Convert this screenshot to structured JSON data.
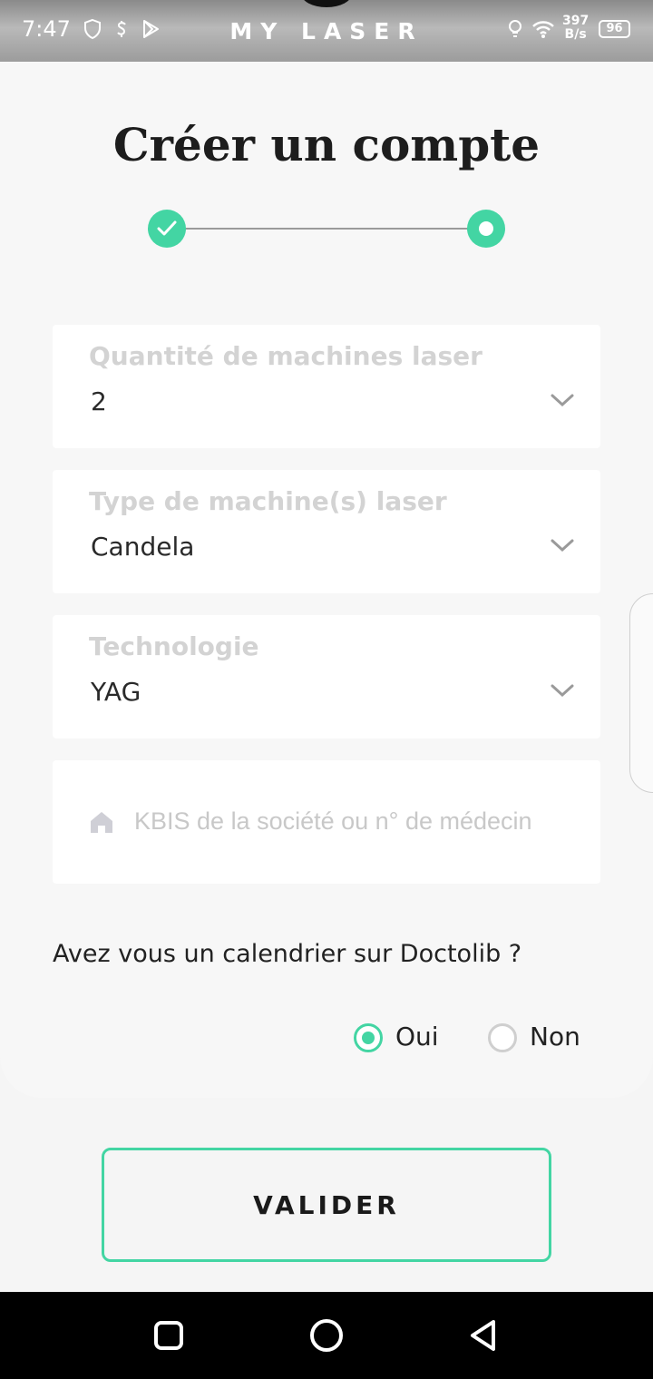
{
  "status_bar": {
    "time": "7:47",
    "app_title": "MY LASER",
    "net_speed_value": "397",
    "net_speed_unit": "B/s",
    "battery": "96"
  },
  "page": {
    "title": "Créer un compte",
    "steps": [
      {
        "state": "completed"
      },
      {
        "state": "active"
      }
    ]
  },
  "form": {
    "quantity": {
      "label": "Quantité de machines laser",
      "value": "2"
    },
    "machine_type": {
      "label": "Type de machine(s) laser",
      "value": "Candela"
    },
    "technology": {
      "label": "Technologie",
      "value": "YAG"
    },
    "kbis": {
      "placeholder": "KBIS de la société ou n° de médecin",
      "icon": "home-icon"
    }
  },
  "doctolib": {
    "question": "Avez vous un calendrier sur Doctolib ?",
    "options": [
      {
        "label": "Oui",
        "selected": true
      },
      {
        "label": "Non",
        "selected": false
      }
    ]
  },
  "submit_label": "VALIDER",
  "colors": {
    "accent": "#43d5a3",
    "background": "#f5f5f5",
    "label_grey": "#d3d3d3",
    "text": "#222222"
  }
}
